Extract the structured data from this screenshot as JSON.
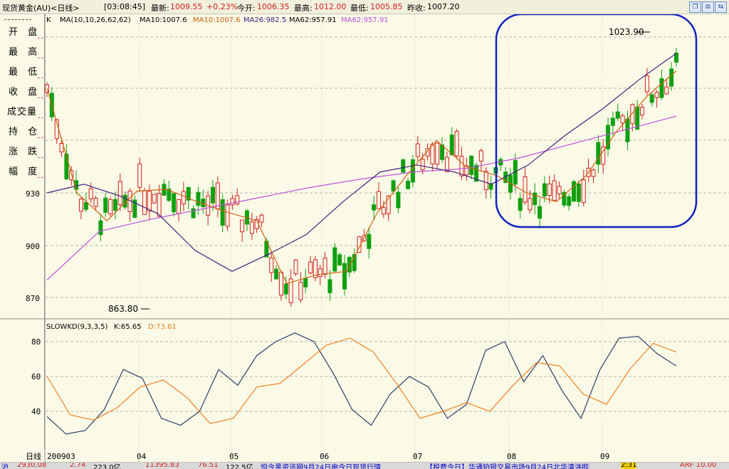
{
  "header": {
    "title": "现货黄金(AU)<日线>",
    "time": "[03:08:45]",
    "latest_label": "最新:",
    "latest_value": "1009.55",
    "change_pct": "+0.23%",
    "open_label": "今开:",
    "open_value": "1006.35",
    "high_label": "最高:",
    "high_value": "1012.00",
    "low_label": "最低:",
    "low_value": "1005.85",
    "prev_close_label": "昨收:",
    "prev_close_value": "1007.20"
  },
  "left_panel": {
    "items": [
      "开 盘",
      "最 高",
      "最 低",
      "收 盘",
      "成交量",
      "持 仓",
      "涨 跌",
      "幅 度"
    ]
  },
  "ma_legend": {
    "k_label": "K",
    "ma_label": "MA(10,10,26,62,62)",
    "ma10_a": "MA10:1007.6",
    "ma10_b": "MA10:1007.6",
    "ma26": "MA26:982.5",
    "ma62_a": "MA62:957.91",
    "ma62_b": "MA62:957.91"
  },
  "kd_legend": {
    "name": "SLOWKD(9,3,3,5)",
    "k": "K:65.65",
    "d": "D:73.61"
  },
  "annotations": {
    "high_mark": "1023.90",
    "low_mark": "863.80"
  },
  "colors": {
    "up": "#d42020",
    "down": "#10a010",
    "ma10": "#d06010",
    "ma26": "#402080",
    "ma62": "#c050e0",
    "k_line": "#2a3f6a",
    "d_line": "#f08020",
    "circle": "#1020c0"
  },
  "chart_data": [
    {
      "type": "candlestick",
      "title": "现货黄金(AU)<日线>",
      "y_ticks": [
        870,
        900,
        930
      ],
      "x_tick_labels": [
        "200903",
        "04",
        "05",
        "06",
        "07",
        "08",
        "09"
      ],
      "series": [
        {
          "name": "MA10",
          "values": [
            990,
            930,
            914,
            931,
            932,
            925,
            919,
            914,
            878,
            883,
            885,
            918,
            940,
            960,
            945,
            940,
            930,
            925,
            940,
            965,
            985,
            1000
          ]
        },
        {
          "name": "MA26",
          "values": [
            930,
            935,
            928,
            918,
            897,
            885,
            895,
            906,
            925,
            942,
            946,
            942,
            935,
            946,
            963,
            978,
            995,
            1010
          ]
        },
        {
          "name": "MA62",
          "values": [
            880,
            908,
            915,
            921,
            927,
            933,
            938,
            942,
            944,
            950,
            958,
            966,
            974
          ]
        }
      ]
    },
    {
      "type": "line",
      "title": "SLOWKD(9,3,3,5)",
      "y_ticks": [
        40,
        60,
        80
      ],
      "ylim": [
        30,
        85
      ],
      "series": [
        {
          "name": "K",
          "values": [
            37,
            27,
            29,
            41,
            64,
            59,
            36,
            32,
            40,
            64,
            55,
            72,
            80,
            85,
            80,
            62,
            41,
            32,
            50,
            60,
            54,
            36,
            44,
            75,
            80,
            57,
            72,
            52,
            36,
            64,
            82,
            83,
            73,
            66
          ]
        },
        {
          "name": "D",
          "values": [
            60,
            38,
            35,
            42,
            54,
            58,
            48,
            33,
            36,
            54,
            56,
            67,
            78,
            82,
            74,
            56,
            36,
            40,
            45,
            40,
            55,
            68,
            66,
            50,
            44,
            64,
            79,
            74
          ]
        }
      ]
    }
  ],
  "bottom": {
    "items": [
      "沪",
      "2930.08",
      "2.74",
      "223.0亿",
      "11395.83",
      "76.51",
      "122.5亿",
      "恒今黑资讯网9月24日电今日现货行情",
      "【税费今日】华通铂银交易市场9月24日北华清油即",
      "2:31",
      "ARF 10.00"
    ]
  }
}
